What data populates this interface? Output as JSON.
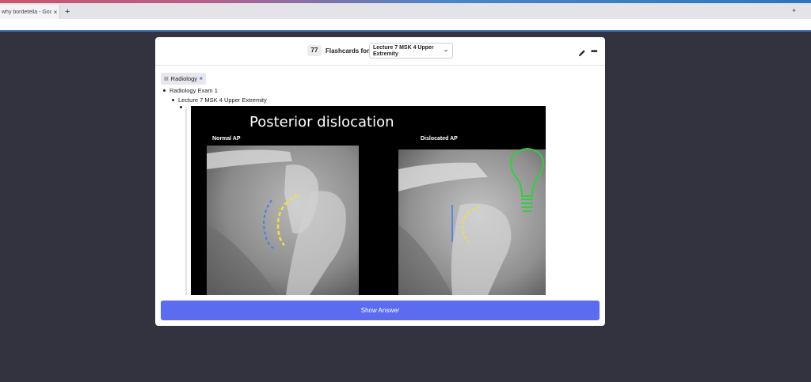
{
  "browser": {
    "tab_title": "why bordetella - Google Se",
    "tab_close": "×",
    "new_tab": "+"
  },
  "header": {
    "count": "77",
    "flashcards_label": "Flashcards  for",
    "deck_name": "Lecture 7 MSK 4 Upper Extremity"
  },
  "tag": {
    "label": "Radiology"
  },
  "breadcrumb": {
    "level1": "Radiology Exam 1",
    "level2": "Lecture 7 MSK 4 Upper Extremity"
  },
  "image": {
    "title": "Posterior dislocation",
    "label_left": "Normal AP",
    "label_right": "Dislocated AP"
  },
  "actions": {
    "show_answer": "Show Answer"
  },
  "colors": {
    "accent": "#5b6cf0",
    "background": "#33333f",
    "yellow_outline": "#f0e040",
    "blue_outline": "#4a7fe0",
    "bulb_green": "#2fd13c"
  }
}
